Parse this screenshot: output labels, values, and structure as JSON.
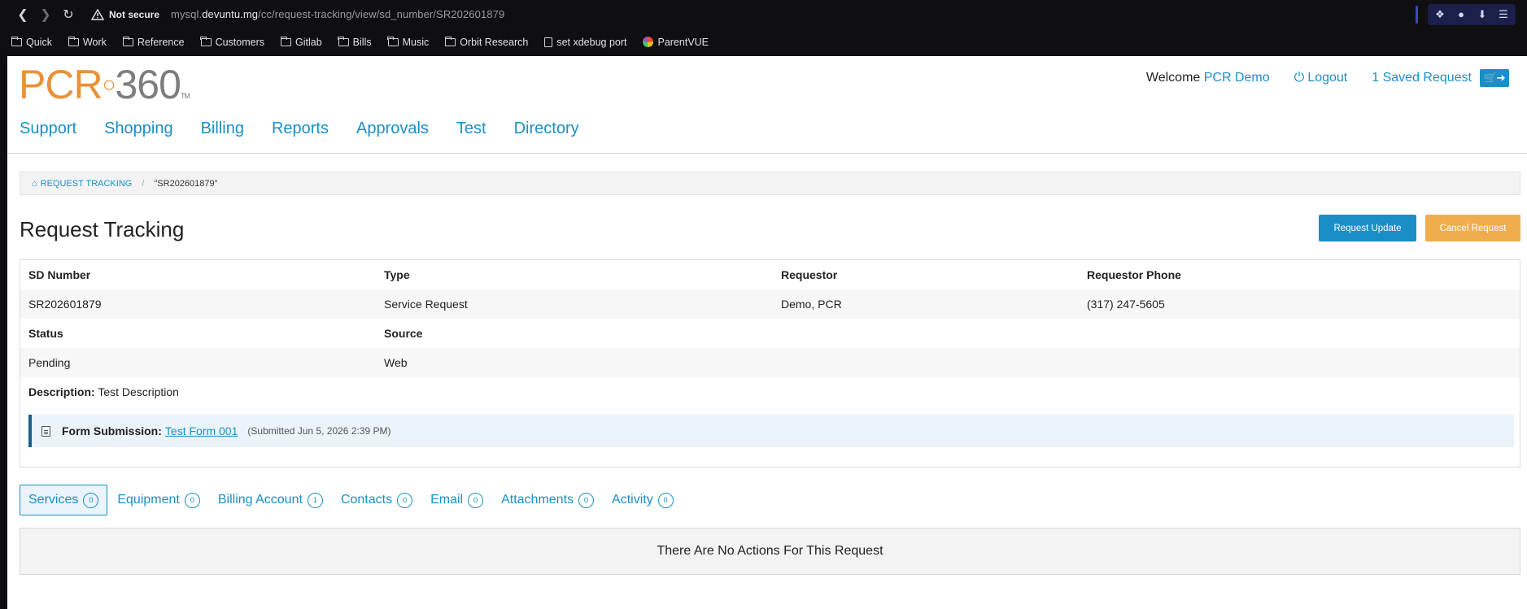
{
  "browser": {
    "security_label": "Not secure",
    "url_prefix": "mysql.",
    "url_host": "devuntu.mg",
    "url_path": "/cc/request-tracking/view/sd_number/SR202601879",
    "bookmarks": [
      {
        "label": "Quick",
        "icon": "folder-icon"
      },
      {
        "label": "Work",
        "icon": "folder-icon"
      },
      {
        "label": "Reference",
        "icon": "folder-icon"
      },
      {
        "label": "Customers",
        "icon": "folder-icon"
      },
      {
        "label": "Gitlab",
        "icon": "folder-icon"
      },
      {
        "label": "Bills",
        "icon": "folder-icon"
      },
      {
        "label": "Music",
        "icon": "folder-icon"
      },
      {
        "label": "Orbit Research",
        "icon": "folder-icon"
      },
      {
        "label": "set xdebug port",
        "icon": "file-icon"
      },
      {
        "label": "ParentVUE",
        "icon": "globe-icon"
      }
    ]
  },
  "header": {
    "logo_pcr": "PCR",
    "logo_num": "360",
    "logo_tm": "TM",
    "welcome": "Welcome",
    "user_name": "PCR Demo",
    "logout": "Logout",
    "saved_request": "1 Saved Request",
    "nav": [
      "Support",
      "Shopping",
      "Billing",
      "Reports",
      "Approvals",
      "Test",
      "Directory"
    ]
  },
  "breadcrumb": {
    "root": "REQUEST TRACKING",
    "separator": "/",
    "current": "\"SR202601879\""
  },
  "main": {
    "title": "Request Tracking",
    "request_update": "Request Update",
    "cancel_request": "Cancel Request"
  },
  "details": {
    "headers1": [
      "SD Number",
      "Type",
      "Requestor",
      "Requestor Phone"
    ],
    "values1": [
      "SR202601879",
      "Service Request",
      "Demo, PCR",
      "(317) 247-5605"
    ],
    "headers2": [
      "Status",
      "Source"
    ],
    "values2": [
      "Pending",
      "Web"
    ],
    "description_label": "Description:",
    "description": "Test Description",
    "form_label": "Form Submission:",
    "form_link": "Test Form 001",
    "form_meta": "(Submitted Jun 5, 2026 2:39 PM)"
  },
  "tabs": [
    {
      "label": "Services",
      "count": "0"
    },
    {
      "label": "Equipment",
      "count": "0"
    },
    {
      "label": "Billing Account",
      "count": "1"
    },
    {
      "label": "Contacts",
      "count": "0"
    },
    {
      "label": "Email",
      "count": "0"
    },
    {
      "label": "Attachments",
      "count": "0"
    },
    {
      "label": "Activity",
      "count": "0"
    }
  ],
  "actions_message": "There Are No Actions For This Request",
  "colors": {
    "accent": "#1a8fc7",
    "warning": "#f0ad4e",
    "logo_orange": "#e8923a"
  }
}
